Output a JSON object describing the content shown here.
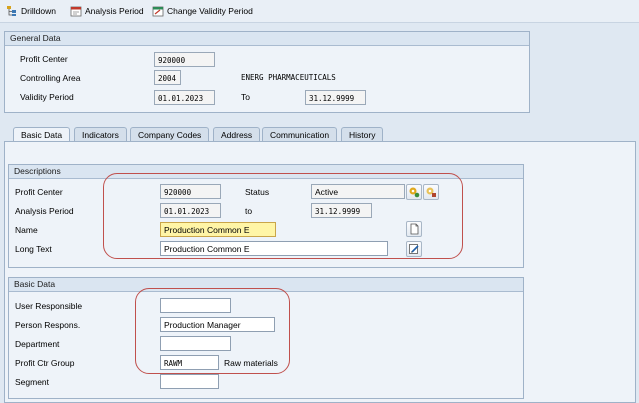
{
  "toolbar": {
    "drilldown": "Drilldown",
    "analysis_period": "Analysis Period",
    "change_validity": "Change Validity Period"
  },
  "general": {
    "title": "General Data",
    "profit_center_label": "Profit Center",
    "profit_center_value": "920000",
    "controlling_area_label": "Controlling Area",
    "controlling_area_value": "2004",
    "controlling_area_text": "ENERG PHARMACEUTICALS",
    "validity_label": "Validity Period",
    "validity_from": "01.01.2023",
    "validity_to_label": "To",
    "validity_to": "31.12.9999"
  },
  "tabs": [
    "Basic Data",
    "Indicators",
    "Company Codes",
    "Address",
    "Communication",
    "History"
  ],
  "descriptions": {
    "title": "Descriptions",
    "profit_center_label": "Profit Center",
    "profit_center_value": "920000",
    "status_label": "Status",
    "status_value": "Active",
    "analysis_label": "Analysis Period",
    "analysis_from": "01.01.2023",
    "to_label": "to",
    "analysis_to": "31.12.9999",
    "name_label": "Name",
    "name_value": "Production Common E",
    "long_text_label": "Long Text",
    "long_text_value": "Production Common E"
  },
  "basic": {
    "title": "Basic Data",
    "user_label": "User Responsible",
    "user_value": "",
    "person_label": "Person Respons.",
    "person_value": "Production Manager",
    "department_label": "Department",
    "department_value": "",
    "group_label": "Profit Ctr Group",
    "group_value": "RAWM",
    "group_text": "Raw materials",
    "segment_label": "Segment",
    "segment_value": ""
  },
  "icons": {
    "drilldown": "drilldown-icon",
    "analysis": "analysis-period-icon",
    "validity": "change-validity-icon",
    "status1": "status-activate-icon",
    "status2": "status-lock-icon",
    "name_btn": "translate-page-icon",
    "longtext_btn": "edit-text-icon"
  },
  "colors": {
    "highlight": "#fff5a6",
    "annotation": "#c0504d",
    "background": "#dfe8f2"
  }
}
